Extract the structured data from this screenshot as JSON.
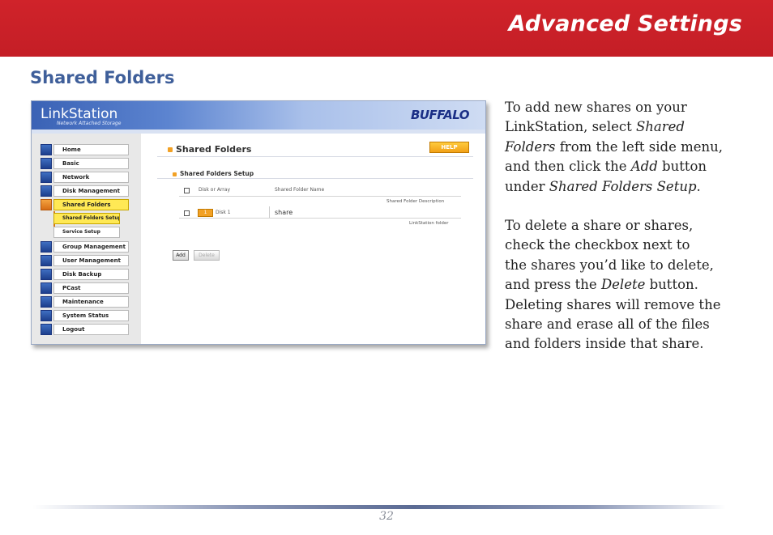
{
  "header": {
    "title": "Advanced Settings"
  },
  "section_heading": "Shared Folders",
  "screenshot": {
    "logo_text": "LinkStation",
    "logo_subtitle": "Network Attached Storage",
    "brand": "BUFFALO",
    "nav": [
      "Home",
      "Basic",
      "Network",
      "Disk Management",
      "Shared Folders",
      "Shared Folders Setup",
      "Service Setup",
      "Group Management",
      "User Management",
      "Disk Backup",
      "PCast",
      "Maintenance",
      "System Status",
      "Logout"
    ],
    "title": "Shared Folders",
    "help_label": "HELP",
    "setup_title": "Shared Folders Setup",
    "columns": {
      "disk": "Disk or Array",
      "name": "Shared Folder Name",
      "description": "Shared Folder Description"
    },
    "row": {
      "disk_icon_text": "1",
      "disk": "Disk 1",
      "name": "share",
      "description": "LinkStation folder"
    },
    "add_label": "Add",
    "delete_label": "Delete"
  },
  "paragraph1": {
    "line1": "To add new shares on your",
    "line2a": "LinkStation, select ",
    "line2b": "Shared",
    "line3a": "Folders",
    "line3b": " from the left side menu,",
    "line4a": "and then click the ",
    "line4b": "Add",
    "line4c": " button",
    "line5a": "under ",
    "line5b": "Shared Folders Setup",
    "line5c": "."
  },
  "paragraph2": {
    "line1": "To delete a share or shares,",
    "line2": "check the checkbox next to",
    "line3": "the shares you’d like to delete,",
    "line4a": "and press the ",
    "line4b": "Delete",
    "line4c": " button.",
    "line5": "Deleting shares will remove the",
    "line6": "share and erase all of the files",
    "line7": "and folders inside that share."
  },
  "footer": {
    "page_number": "32"
  }
}
